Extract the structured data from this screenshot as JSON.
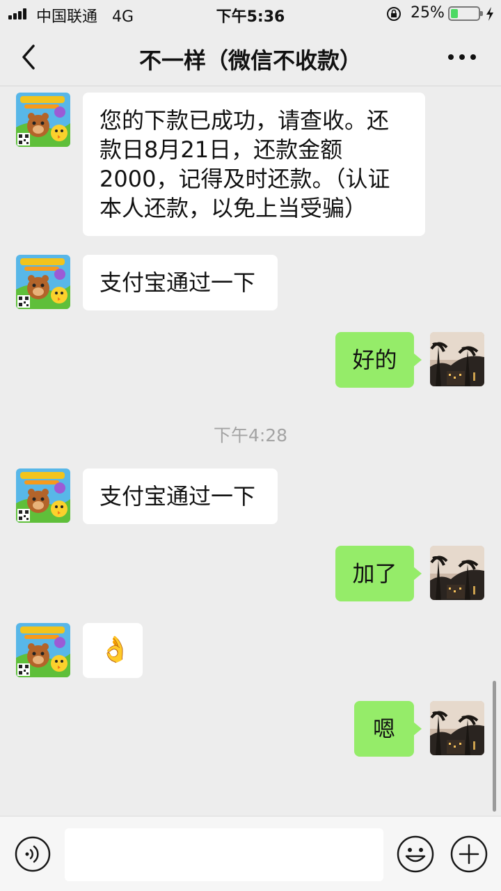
{
  "status_bar": {
    "carrier": "中国联通",
    "network": "4G",
    "time": "下午5:36",
    "battery_percent_label": "25%",
    "battery_level": 0.25,
    "battery_color": "#4cd964",
    "icons": [
      "signal-icon",
      "orientation-lock-icon",
      "battery-icon",
      "charging-bolt-icon"
    ]
  },
  "nav": {
    "title": "不一样（微信不收款）",
    "back_icon": "chevron-left-icon",
    "more_icon": "more-dots-icon"
  },
  "messages": [
    {
      "from": "contact",
      "text": "您的下款已成功，请查收。还款日8月21日，还款金额2000，记得及时还款。（认证本人还款，以免上当受骗）"
    },
    {
      "from": "contact",
      "text": "支付宝通过一下"
    },
    {
      "from": "me",
      "text": "好的"
    },
    {
      "from": "system",
      "text": "下午4:28"
    },
    {
      "from": "contact",
      "text": "支付宝通过一下"
    },
    {
      "from": "me",
      "text": "加了"
    },
    {
      "from": "contact",
      "text": "👌"
    },
    {
      "from": "me",
      "text": "嗯"
    }
  ],
  "input_bar": {
    "voice_icon": "voice-icon",
    "placeholder": "",
    "emoji_icon": "smile-icon",
    "plus_icon": "plus-icon"
  },
  "colors": {
    "background": "#ededed",
    "incoming_bubble": "#ffffff",
    "outgoing_bubble": "#95ec69",
    "timestamp": "#a3a3a3"
  }
}
